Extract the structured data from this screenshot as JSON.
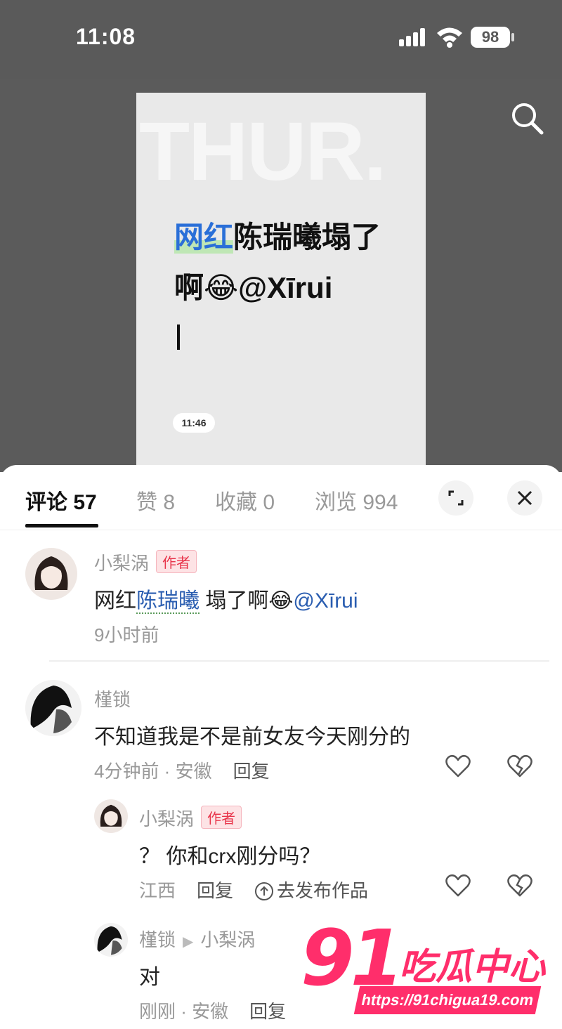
{
  "status_bar": {
    "time": "11:08",
    "battery": "98"
  },
  "video": {
    "bg_text": "THUR.",
    "title_highlight": "网红",
    "title_rest": "陈瑞曦塌了啊😂@Xīrui",
    "timestamp": "11:46"
  },
  "tabs": [
    {
      "label": "评论 57"
    },
    {
      "label": "赞 8"
    },
    {
      "label": "收藏 0"
    },
    {
      "label": "浏览 994"
    }
  ],
  "comments": {
    "c0": {
      "name": "小梨涡",
      "badge": "作者",
      "text_pre": "网红",
      "text_link": "陈瑞曦",
      "text_post": " 塌了啊😂",
      "mention": "@Xīrui",
      "time": "9小时前"
    },
    "c1": {
      "name": "槿锁",
      "text": "不知道我是不是前女友今天刚分的",
      "meta": "4分钟前 · 安徽",
      "reply": "回复"
    },
    "c2": {
      "name": "小梨涡",
      "badge": "作者",
      "text": "？ 你和crx刚分吗？",
      "meta": "江西",
      "reply": "回复",
      "publish": "去发布作品"
    },
    "c3": {
      "name": "槿锁",
      "reply_to": "小梨涡",
      "text": "对",
      "meta": "刚刚 · 安徽",
      "reply": "回复"
    }
  },
  "watermark": {
    "num": "91",
    "cn": "吃瓜中心",
    "url": "https://91chigua19.com"
  },
  "colors": {
    "accent": "#ff2e6b",
    "link": "#2a5db0",
    "badge": "#e8344a"
  }
}
